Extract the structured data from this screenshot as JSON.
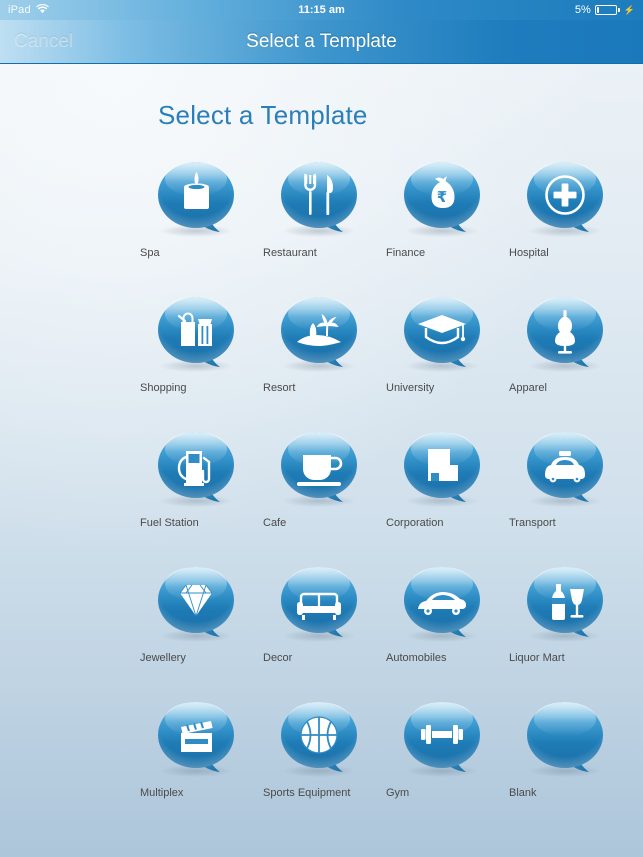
{
  "status_bar": {
    "device_label": "iPad",
    "wifi_icon": "wifi-icon",
    "time": "11:15 am",
    "battery_percent": "5%",
    "battery_icon": "battery-icon",
    "charging_icon": "lightning-bolt-icon"
  },
  "nav_bar": {
    "cancel_label": "Cancel",
    "title": "Select a Template"
  },
  "content": {
    "page_title": "Select a Template"
  },
  "colors": {
    "nav_blue": "#1f7dbe",
    "title_blue": "#2a7fb8",
    "bubble_blue_light": "#7fc4e8",
    "bubble_blue_dark": "#1a6ea8",
    "label_gray": "#4a4a4a"
  },
  "templates": [
    {
      "label": "Spa",
      "icon": "candle-icon"
    },
    {
      "label": "Restaurant",
      "icon": "fork-knife-icon"
    },
    {
      "label": "Finance",
      "icon": "money-bag-rupee-icon"
    },
    {
      "label": "Hospital",
      "icon": "medical-plus-circle-icon"
    },
    {
      "label": "Shopping",
      "icon": "shopping-bags-icon"
    },
    {
      "label": "Resort",
      "icon": "island-palm-tree-icon"
    },
    {
      "label": "University",
      "icon": "graduation-cap-icon"
    },
    {
      "label": "Apparel",
      "icon": "dress-mannequin-icon"
    },
    {
      "label": "Fuel Station",
      "icon": "fuel-pump-icon"
    },
    {
      "label": "Cafe",
      "icon": "coffee-cup-icon"
    },
    {
      "label": "Corporation",
      "icon": "office-buildings-icon"
    },
    {
      "label": "Transport",
      "icon": "taxi-car-icon"
    },
    {
      "label": "Jewellery",
      "icon": "diamond-icon"
    },
    {
      "label": "Decor",
      "icon": "sofa-icon"
    },
    {
      "label": "Automobiles",
      "icon": "car-icon"
    },
    {
      "label": "Liquor Mart",
      "icon": "bottle-wine-glass-icon"
    },
    {
      "label": "Multiplex",
      "icon": "clapperboard-icon"
    },
    {
      "label": "Sports Equipment",
      "icon": "basketball-icon"
    },
    {
      "label": "Gym",
      "icon": "dumbbell-icon"
    },
    {
      "label": "Blank",
      "icon": "none"
    }
  ]
}
